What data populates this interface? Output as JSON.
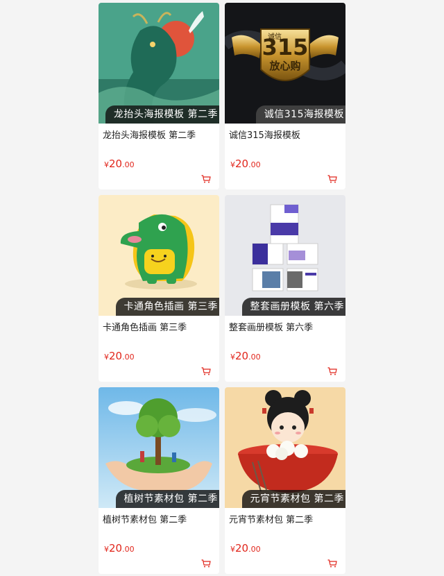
{
  "products": [
    {
      "overlay": "龙抬头海报模板 第二季",
      "title": "龙抬头海报模板 第二季",
      "currency": "¥",
      "price_int": "20",
      "price_dec": ".00",
      "image": "dragon"
    },
    {
      "overlay": "诚信315海报模板",
      "title": "诚信315海报模板",
      "currency": "¥",
      "price_int": "20",
      "price_dec": ".00",
      "image": "badge-315",
      "badge_text": "315",
      "badge_sub": "放心购",
      "badge_top": "诚信"
    },
    {
      "overlay": "卡通角色插画 第三季",
      "title": "卡通角色插画 第三季",
      "currency": "¥",
      "price_int": "20",
      "price_dec": ".00",
      "image": "cartoon-dinosaur"
    },
    {
      "overlay": "整套画册模板 第六季",
      "title": "整套画册模板 第六季",
      "currency": "¥",
      "price_int": "20",
      "price_dec": ".00",
      "image": "brochure"
    },
    {
      "overlay": "植树节素材包 第二季",
      "title": "植树节素材包 第二季",
      "currency": "¥",
      "price_int": "20",
      "price_dec": ".00",
      "image": "tree-hands"
    },
    {
      "overlay": "元宵节素材包 第二季",
      "title": "元宵节素材包 第二季",
      "currency": "¥",
      "price_int": "20",
      "price_dec": ".00",
      "image": "lantern-girl"
    }
  ],
  "colors": {
    "price": "#e1251b",
    "page_bg": "#f4f4f4",
    "overlay_bg": "#141414"
  },
  "icons": {
    "cart": "cart-icon"
  }
}
